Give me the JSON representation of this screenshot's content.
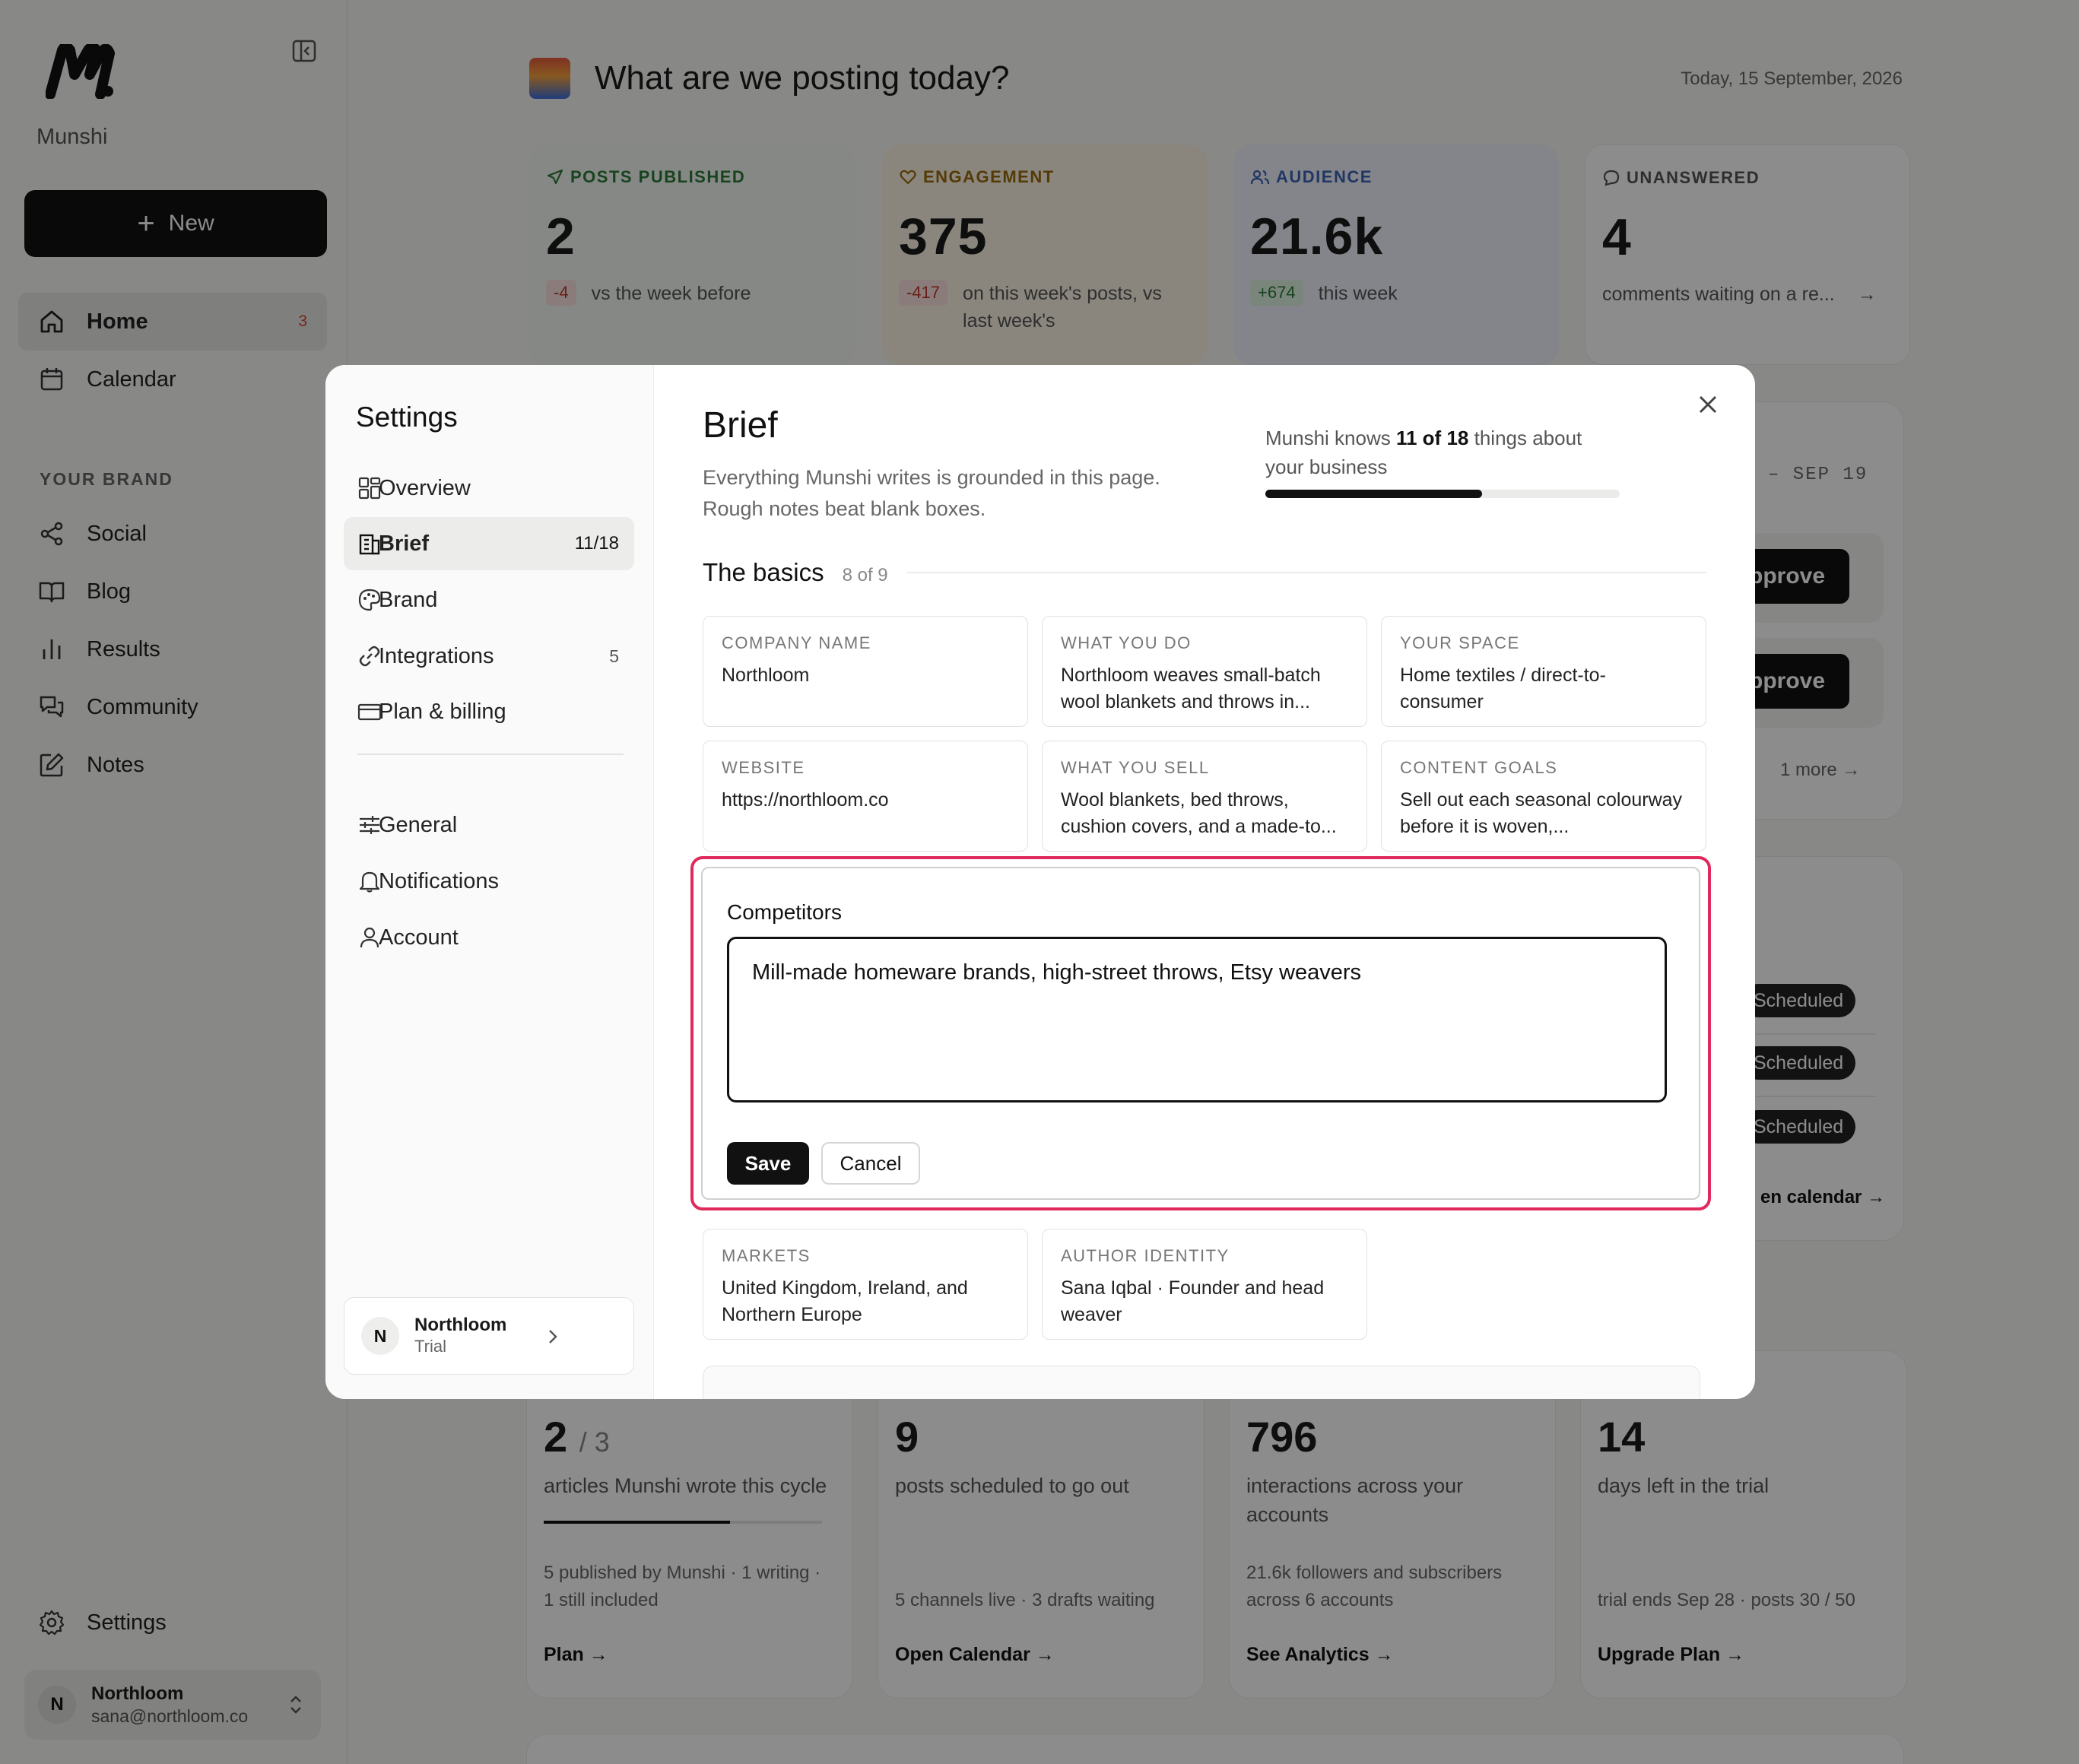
{
  "app": {
    "name": "Munshi"
  },
  "sidebar": {
    "new_label": "New",
    "nav": [
      {
        "label": "Home",
        "badge": "3"
      },
      {
        "label": "Calendar"
      }
    ],
    "section_label": "YOUR BRAND",
    "brand_nav": [
      {
        "label": "Social"
      },
      {
        "label": "Blog"
      },
      {
        "label": "Results"
      },
      {
        "label": "Community"
      },
      {
        "label": "Notes"
      }
    ],
    "settings_label": "Settings",
    "user": {
      "initial": "N",
      "name": "Northloom",
      "email": "sana@northloom.co"
    }
  },
  "dashboard": {
    "title": "What are we posting today?",
    "date": "Today, 15 September, 2026",
    "stats": [
      {
        "label": "POSTS PUBLISHED",
        "value": "2",
        "delta": "-4",
        "note": "vs the week before",
        "color": "#2d7a3a"
      },
      {
        "label": "ENGAGEMENT",
        "value": "375",
        "delta": "-417",
        "note": "on this week's posts, vs last week's",
        "color": "#b8860b"
      },
      {
        "label": "AUDIENCE",
        "value": "21.6k",
        "delta": "+674",
        "note": "this week",
        "color": "#3f63b5"
      },
      {
        "label": "UNANSWERED",
        "value": "4",
        "note": "comments waiting on a re...",
        "color": "#555555"
      }
    ],
    "schedule_range": "– SEP 19",
    "approve_label": "pprove",
    "more_label": "1 more",
    "scheduled_label": "Scheduled",
    "calendar_link": "en calendar →",
    "bottom_cards": [
      {
        "value": "2",
        "suffix": "/ 3",
        "desc": "articles Munshi wrote this cycle",
        "progress": 0.67,
        "foot": "5 published by Munshi · 1 writing · 1 still included",
        "link": "Plan →"
      },
      {
        "value": "9",
        "desc": "posts scheduled to go out",
        "foot": "5 channels live · 3 drafts waiting",
        "link": "Open Calendar →"
      },
      {
        "value": "796",
        "desc": "interactions across your accounts",
        "foot": "21.6k followers and subscribers across 6 accounts",
        "link": "See Analytics →"
      },
      {
        "value": "14",
        "desc": "days left in the trial",
        "foot": "trial ends Sep 28 · posts 30 / 50",
        "link": "Upgrade Plan →"
      }
    ]
  },
  "settings_modal": {
    "title": "Settings",
    "nav": [
      {
        "label": "Overview"
      },
      {
        "label": "Brief",
        "count": "11/18"
      },
      {
        "label": "Brand"
      },
      {
        "label": "Integrations",
        "count": "5"
      },
      {
        "label": "Plan & billing"
      }
    ],
    "nav2": [
      {
        "label": "General"
      },
      {
        "label": "Notifications"
      },
      {
        "label": "Account"
      }
    ],
    "workspace": {
      "initial": "N",
      "name": "Northloom",
      "plan": "Trial"
    },
    "brief": {
      "title": "Brief",
      "description": "Everything Munshi writes is grounded in this page. Rough notes beat blank boxes.",
      "knows_prefix": "Munshi knows",
      "knows_count": "11 of 18",
      "knows_suffix": "things about your business",
      "progress": 0.611,
      "section_title": "The basics",
      "section_count": "8 of 9",
      "fields": [
        {
          "label": "COMPANY NAME",
          "value": "Northloom"
        },
        {
          "label": "WHAT YOU DO",
          "value": "Northloom weaves small-batch wool blankets and throws in..."
        },
        {
          "label": "YOUR SPACE",
          "value": "Home textiles / direct-to-consumer"
        },
        {
          "label": "WEBSITE",
          "value": "https://northloom.co"
        },
        {
          "label": "WHAT YOU SELL",
          "value": "Wool blankets, bed throws, cushion covers, and a made-to..."
        },
        {
          "label": "CONTENT GOALS",
          "value": "Sell out each seasonal colourway before it is woven,..."
        },
        {
          "label": "MARKETS",
          "value": "United Kingdom, Ireland, and Northern Europe"
        },
        {
          "label": "AUTHOR IDENTITY",
          "value": "Sana Iqbal · Founder and head weaver"
        }
      ],
      "editing": {
        "label": "Competitors",
        "value": "Mill-made homeware brands, high-street throws, Etsy weavers",
        "save_label": "Save",
        "cancel_label": "Cancel"
      }
    }
  }
}
